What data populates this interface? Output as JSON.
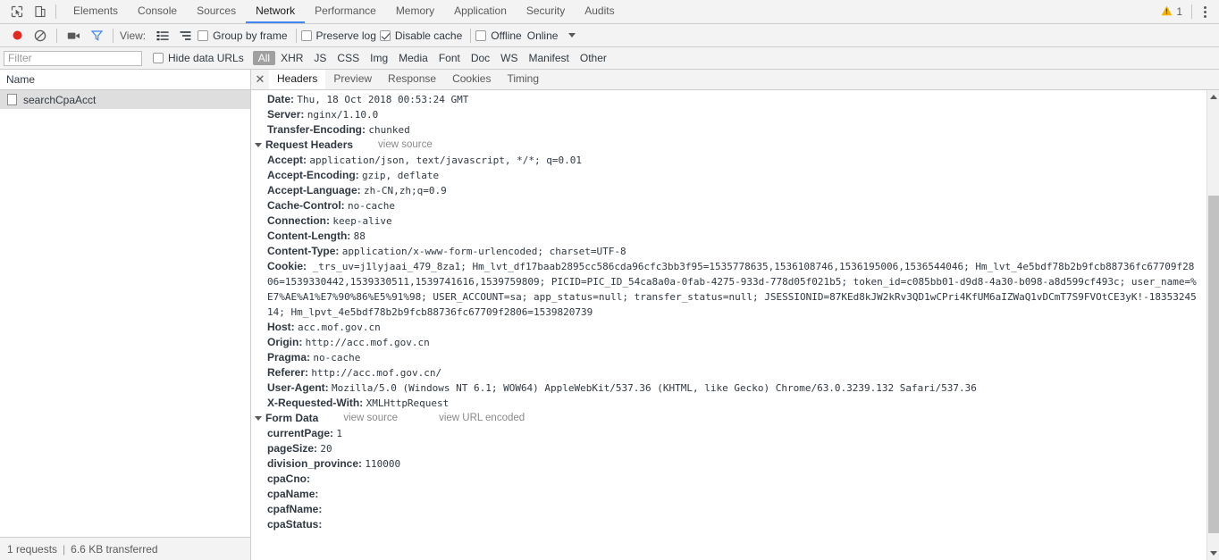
{
  "main_tabs": {
    "inspect_icon": "inspect-element-icon",
    "device_icon": "device-toolbar-icon",
    "items": [
      {
        "label": "Elements",
        "selected": false
      },
      {
        "label": "Console",
        "selected": false
      },
      {
        "label": "Sources",
        "selected": false
      },
      {
        "label": "Network",
        "selected": true
      },
      {
        "label": "Performance",
        "selected": false
      },
      {
        "label": "Memory",
        "selected": false
      },
      {
        "label": "Application",
        "selected": false
      },
      {
        "label": "Security",
        "selected": false
      },
      {
        "label": "Audits",
        "selected": false
      }
    ],
    "warning_count": "1",
    "warning_icon": "warning-triangle-icon",
    "menu_icon": "more-vertical-icon",
    "accent_color": "#4285f4"
  },
  "toolbar": {
    "record_icon": "record-circle-icon",
    "record_color": "#e8271e",
    "clear_icon": "clear-prohibited-icon",
    "capture_screenshots_icon": "camera-icon",
    "filter_icon": "funnel-icon",
    "filter_icon_color": "#4285f4",
    "view_label": "View:",
    "view_list_icon": "list-view-icon",
    "view_waterfall_icon": "waterfall-view-icon",
    "group_by_frame": {
      "label": "Group by frame",
      "checked": false
    },
    "preserve_log": {
      "label": "Preserve log",
      "checked": false
    },
    "disable_cache": {
      "label": "Disable cache",
      "checked": true
    },
    "offline": {
      "label": "Offline",
      "checked": false
    },
    "online_label": "Online",
    "more_icon": "chevron-down-icon"
  },
  "filterbar": {
    "placeholder": "Filter",
    "value": "",
    "hide_data_urls": {
      "label": "Hide data URLs",
      "checked": false
    },
    "types": [
      {
        "label": "All",
        "active": true
      },
      {
        "label": "XHR",
        "active": false
      },
      {
        "label": "JS",
        "active": false
      },
      {
        "label": "CSS",
        "active": false
      },
      {
        "label": "Img",
        "active": false
      },
      {
        "label": "Media",
        "active": false
      },
      {
        "label": "Font",
        "active": false
      },
      {
        "label": "Doc",
        "active": false
      },
      {
        "label": "WS",
        "active": false
      },
      {
        "label": "Manifest",
        "active": false
      },
      {
        "label": "Other",
        "active": false
      }
    ]
  },
  "requests_panel": {
    "column_header": "Name",
    "rows": [
      {
        "name": "searchCpaAcct",
        "icon": "document-icon",
        "selected": true
      }
    ],
    "status": {
      "requests": "1 requests",
      "separator": "|",
      "transferred": "6.6 KB transferred"
    }
  },
  "details_panel": {
    "close_icon": "close-icon",
    "tabs": [
      {
        "label": "Headers",
        "selected": true
      },
      {
        "label": "Preview",
        "selected": false
      },
      {
        "label": "Response",
        "selected": false
      },
      {
        "label": "Cookies",
        "selected": false
      },
      {
        "label": "Timing",
        "selected": false
      }
    ],
    "response_headers_visible": [
      {
        "name": "Date:",
        "value": "Thu, 18 Oct 2018 00:53:24 GMT"
      },
      {
        "name": "Server:",
        "value": "nginx/1.10.0"
      },
      {
        "name": "Transfer-Encoding:",
        "value": "chunked"
      }
    ],
    "request_headers_section": {
      "title": "Request Headers",
      "view_source": "view source",
      "expanded": true
    },
    "request_headers": [
      {
        "name": "Accept:",
        "value": "application/json, text/javascript, */*; q=0.01"
      },
      {
        "name": "Accept-Encoding:",
        "value": "gzip, deflate"
      },
      {
        "name": "Accept-Language:",
        "value": "zh-CN,zh;q=0.9"
      },
      {
        "name": "Cache-Control:",
        "value": "no-cache"
      },
      {
        "name": "Connection:",
        "value": "keep-alive"
      },
      {
        "name": "Content-Length:",
        "value": "88"
      },
      {
        "name": "Content-Type:",
        "value": "application/x-www-form-urlencoded; charset=UTF-8"
      }
    ],
    "cookie_header": {
      "name": "Cookie:",
      "lines": [
        "_trs_uv=j1lyjaai_479_8za1; Hm_lvt_df17baab2895cc586cda96cfc3bb3f95=1535778635,1536108746,1536195006,1536544046; Hm_lvt_4e5bdf78b2b9fcb88736fc67709f28",
        "06=1539330442,1539330511,1539741616,1539759809; PICID=PIC_ID_54ca8a0a-0fab-4275-933d-778d05f021b5; token_id=c085bb01-d9d8-4a30-b098-a8d599cf493c; user_name=%",
        "E7%AE%A1%E7%90%86%E5%91%98; USER_ACCOUNT=sa; app_status=null; transfer_status=null; JSESSIONID=87KEd8kJW2kRv3QD1wCPri4KfUM6aIZWaQ1vDCmT7S9FVOtCE3yK!-18353245",
        "14; Hm_lpvt_4e5bdf78b2b9fcb88736fc67709f2806=1539820739"
      ]
    },
    "request_headers_tail": [
      {
        "name": "Host:",
        "value": "acc.mof.gov.cn"
      },
      {
        "name": "Origin:",
        "value": "http://acc.mof.gov.cn"
      },
      {
        "name": "Pragma:",
        "value": "no-cache"
      },
      {
        "name": "Referer:",
        "value": "http://acc.mof.gov.cn/"
      },
      {
        "name": "User-Agent:",
        "value": "Mozilla/5.0 (Windows NT 6.1; WOW64) AppleWebKit/537.36 (KHTML, like Gecko) Chrome/63.0.3239.132 Safari/537.36"
      },
      {
        "name": "X-Requested-With:",
        "value": "XMLHttpRequest"
      }
    ],
    "form_data_section": {
      "title": "Form Data",
      "view_source": "view source",
      "view_url_encoded": "view URL encoded",
      "expanded": true
    },
    "form_data": [
      {
        "name": "currentPage:",
        "value": "1"
      },
      {
        "name": "pageSize:",
        "value": "20"
      },
      {
        "name": "division_province:",
        "value": "110000"
      },
      {
        "name": "cpaCno:",
        "value": ""
      },
      {
        "name": "cpaName:",
        "value": ""
      },
      {
        "name": "cpafName:",
        "value": ""
      },
      {
        "name": "cpaStatus:",
        "value": ""
      }
    ],
    "scrollbar": {
      "up_icon": "scroll-up-arrow-icon",
      "down_icon": "scroll-down-arrow-icon"
    }
  }
}
